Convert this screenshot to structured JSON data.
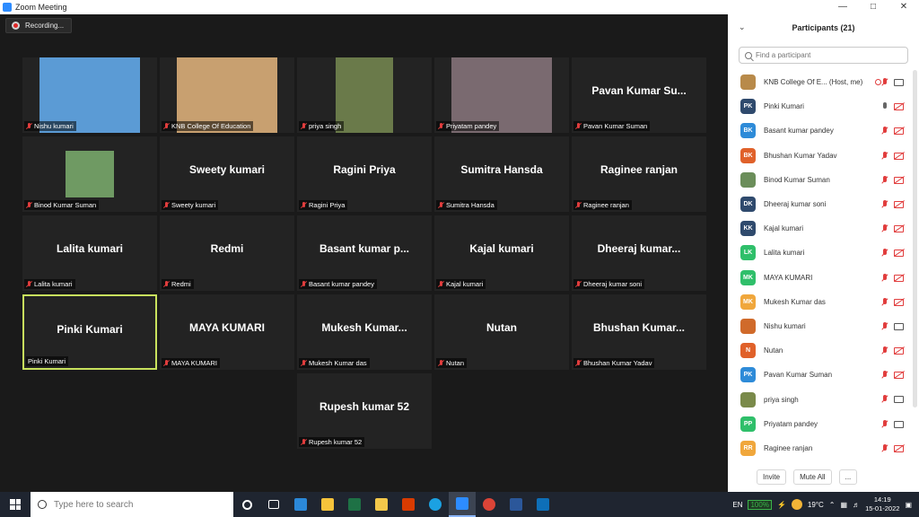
{
  "window": {
    "title": "Zoom Meeting"
  },
  "recording": {
    "label": "Recording..."
  },
  "tiles": [
    {
      "big": "",
      "tag": "Nishu kumari",
      "video": true
    },
    {
      "big": "",
      "tag": "KNB College Of Education",
      "video": true
    },
    {
      "big": "",
      "tag": "priya singh",
      "video": true
    },
    {
      "big": "",
      "tag": "Priyatam pandey",
      "video": true
    },
    {
      "big": "Pavan Kumar Su...",
      "tag": "Pavan Kumar Suman",
      "video": false
    },
    {
      "big": "",
      "tag": "Binod Kumar Suman",
      "video": true
    },
    {
      "big": "Sweety kumari",
      "tag": "Sweety kumari",
      "video": false
    },
    {
      "big": "Ragini  Priya",
      "tag": "Ragini  Priya",
      "video": false
    },
    {
      "big": "Sumitra Hansda",
      "tag": "Sumitra Hansda",
      "video": false
    },
    {
      "big": "Raginee ranjan",
      "tag": "Raginee ranjan",
      "video": false
    },
    {
      "big": "Lalita kumari",
      "tag": "Lalita kumari",
      "video": false
    },
    {
      "big": "Redmi",
      "tag": "Redmi",
      "video": false
    },
    {
      "big": "Basant kumar p...",
      "tag": "Basant kumar pandey",
      "video": false
    },
    {
      "big": "Kajal kumari",
      "tag": "Kajal kumari",
      "video": false
    },
    {
      "big": "Dheeraj  kumar...",
      "tag": "Dheeraj kumar soni",
      "video": false
    },
    {
      "big": "Pinki Kumari",
      "tag": "Pinki Kumari",
      "video": false
    },
    {
      "big": "MAYA KUMARI",
      "tag": "MAYA KUMARI",
      "video": false
    },
    {
      "big": "Mukesh  Kumar...",
      "tag": "Mukesh Kumar das",
      "video": false
    },
    {
      "big": "Nutan",
      "tag": "Nutan",
      "video": false
    },
    {
      "big": "Bhushan  Kumar...",
      "tag": "Bhushan Kumar Yadav",
      "video": false
    },
    {
      "big": "Rupesh kumar 52",
      "tag": "Rupesh kumar 52",
      "video": false
    }
  ],
  "participants_panel": {
    "title": "Participants (21)",
    "search_placeholder": "Find a participant",
    "items": [
      {
        "name": "KNB College Of E...   (Host, me)",
        "initials": "",
        "color": "#b88a4a",
        "mic": "muted",
        "cam": "on",
        "host": true
      },
      {
        "name": "Pinki Kumari",
        "initials": "PK",
        "color": "#2f4a6d",
        "mic": "on",
        "cam": "off"
      },
      {
        "name": "Basant kumar pandey",
        "initials": "BK",
        "color": "#2e8bd8",
        "mic": "muted",
        "cam": "off"
      },
      {
        "name": "Bhushan Kumar Yadav",
        "initials": "BK",
        "color": "#e0612a",
        "mic": "muted",
        "cam": "off"
      },
      {
        "name": "Binod Kumar Suman",
        "initials": "",
        "color": "#6b8e5a",
        "mic": "muted",
        "cam": "off"
      },
      {
        "name": "Dheeraj kumar soni",
        "initials": "DK",
        "color": "#2f4a6d",
        "mic": "muted",
        "cam": "off"
      },
      {
        "name": "Kajal kumari",
        "initials": "KK",
        "color": "#2f4a6d",
        "mic": "muted",
        "cam": "off"
      },
      {
        "name": "Lalita kumari",
        "initials": "LK",
        "color": "#2fbf6a",
        "mic": "muted",
        "cam": "off"
      },
      {
        "name": "MAYA KUMARI",
        "initials": "MK",
        "color": "#2fbf6a",
        "mic": "muted",
        "cam": "off"
      },
      {
        "name": "Mukesh Kumar das",
        "initials": "MK",
        "color": "#f0a73c",
        "mic": "muted",
        "cam": "off"
      },
      {
        "name": "Nishu kumari",
        "initials": "",
        "color": "#d06a2a",
        "mic": "muted",
        "cam": "on"
      },
      {
        "name": "Nutan",
        "initials": "N",
        "color": "#e0612a",
        "mic": "muted",
        "cam": "off"
      },
      {
        "name": "Pavan Kumar Suman",
        "initials": "PK",
        "color": "#2e8bd8",
        "mic": "muted",
        "cam": "off"
      },
      {
        "name": "priya singh",
        "initials": "",
        "color": "#7a8a4a",
        "mic": "muted",
        "cam": "on"
      },
      {
        "name": "Priyatam pandey",
        "initials": "PP",
        "color": "#2fbf6a",
        "mic": "muted",
        "cam": "on"
      },
      {
        "name": "Raginee ranjan",
        "initials": "RR",
        "color": "#f0a73c",
        "mic": "muted",
        "cam": "off"
      }
    ],
    "invite_label": "Invite",
    "mute_all_label": "Mute All",
    "more_label": "..."
  },
  "taskbar": {
    "search_placeholder": "Type here to search",
    "language": "EN",
    "battery": "100%",
    "weather": "19°C",
    "time": "14:19",
    "date": "15-01-2022"
  }
}
